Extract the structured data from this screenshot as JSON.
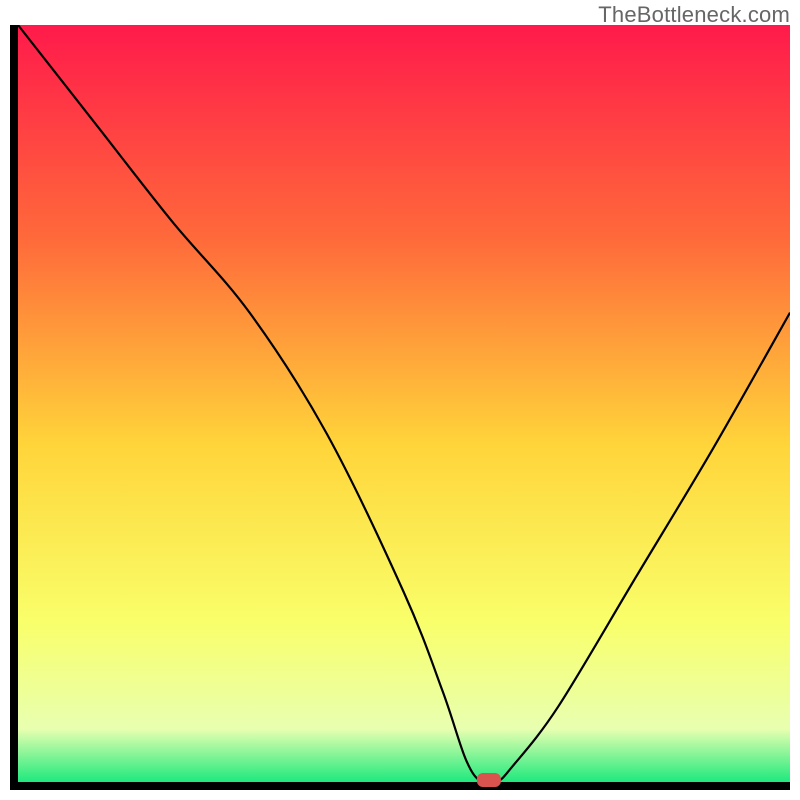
{
  "attribution": "TheBottleneck.com",
  "colors": {
    "gradient_top": "#ff1a4b",
    "gradient_mid_upper": "#ff6a3a",
    "gradient_mid": "#ffd53a",
    "gradient_mid_lower": "#f9ff6a",
    "gradient_lower": "#e8ffb0",
    "gradient_bottom": "#00e676",
    "curve": "#000000",
    "marker": "#d9534f",
    "axis": "#000000"
  },
  "chart_data": {
    "type": "line",
    "title": "",
    "xlabel": "",
    "ylabel": "",
    "xlim": [
      0,
      100
    ],
    "ylim": [
      0,
      100
    ],
    "grid": false,
    "legend": false,
    "series": [
      {
        "name": "bottleneck-curve",
        "x": [
          0,
          10,
          20,
          30,
          40,
          50,
          55,
          58,
          60,
          62,
          64,
          70,
          80,
          90,
          100
        ],
        "values": [
          100,
          87,
          74,
          62,
          46,
          25,
          12,
          3,
          0,
          0,
          2,
          10,
          27,
          44,
          62
        ]
      }
    ],
    "annotations": [
      {
        "name": "optimal-marker",
        "x": 61,
        "y": 0,
        "shape": "pill",
        "color": "#d9534f"
      }
    ]
  }
}
